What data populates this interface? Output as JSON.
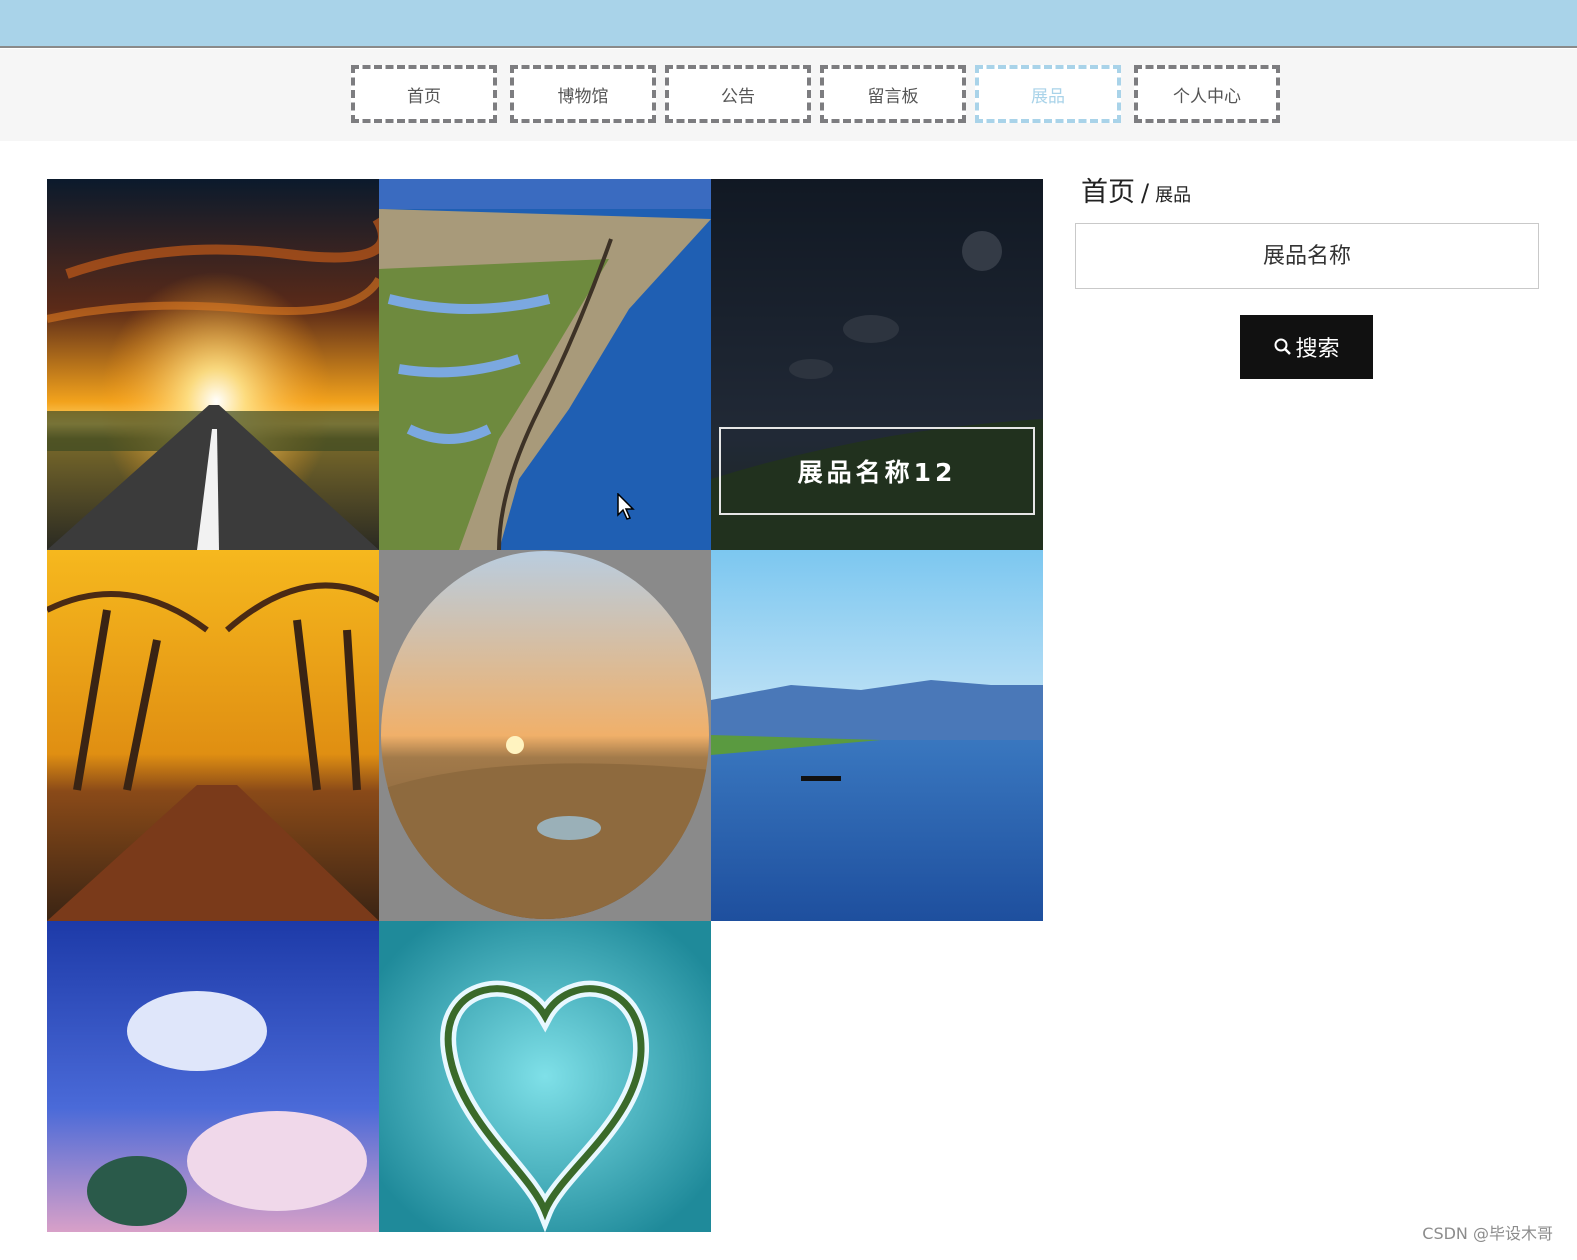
{
  "nav": {
    "items": [
      {
        "label": "首页",
        "active": false
      },
      {
        "label": "博物馆",
        "active": false
      },
      {
        "label": "公告",
        "active": false
      },
      {
        "label": "留言板",
        "active": false
      },
      {
        "label": "展品",
        "active": true
      },
      {
        "label": "个人中心",
        "active": false
      }
    ]
  },
  "gallery": {
    "items": [
      {
        "image": "sunset-road",
        "caption": ""
      },
      {
        "image": "aerial-coastline",
        "caption": ""
      },
      {
        "image": "dark-meadow-sky",
        "caption": "展品名称12",
        "hovered": true
      },
      {
        "image": "autumn-tree-avenue",
        "caption": ""
      },
      {
        "image": "desert-oasis-sunrise",
        "caption": ""
      },
      {
        "image": "blue-lake-boat",
        "caption": ""
      },
      {
        "image": "anime-cloud-sky",
        "caption": ""
      },
      {
        "image": "heart-island",
        "caption": ""
      }
    ]
  },
  "sidebar": {
    "breadcrumb": {
      "home": "首页",
      "separator": "/",
      "current": "展品"
    },
    "search": {
      "placeholder": "展品名称",
      "button_label": "搜索",
      "button_icon": "search-icon"
    }
  },
  "watermark": "CSDN @毕设木哥",
  "colors": {
    "accent": "#a9d3e9",
    "nav_border": "#7d7d80",
    "button": "#111111"
  }
}
